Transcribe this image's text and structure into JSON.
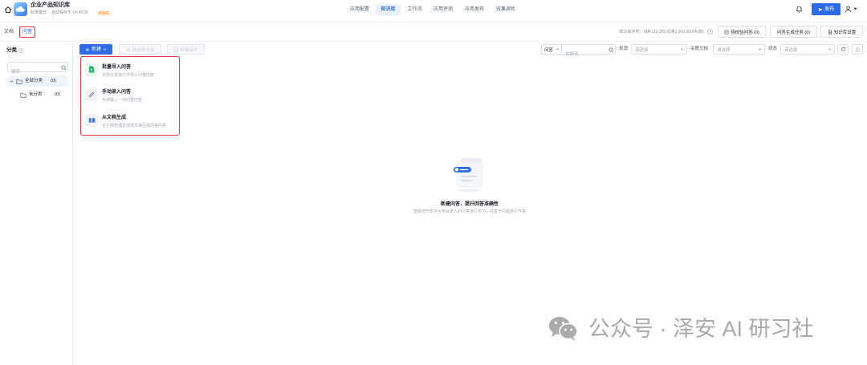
{
  "header": {
    "app_title": "企业产品知识库",
    "mode": "标准模式",
    "autosave": "自动保存于 14:49:56",
    "status_badge": "待发布",
    "nav_tabs": [
      {
        "label": "应用配置",
        "active": false
      },
      {
        "label": "知识库",
        "active": true
      },
      {
        "label": "工作流",
        "active": false
      },
      {
        "label": "应用评测",
        "active": false
      },
      {
        "label": "应用发布",
        "active": false
      },
      {
        "label": "效果调优",
        "active": false
      }
    ],
    "publish_label": "发布"
  },
  "subnav": {
    "tabs": [
      {
        "label": "文档",
        "active": false
      },
      {
        "label": "问答",
        "active": true
      }
    ],
    "usage_text": "知识库字符：消耗119,081/总量2,000,000/失效0",
    "pending_review_label": "待校验问答 (0)",
    "generation_tasks_label": "问答生成任务 (0)",
    "settings_label": "知识库设置"
  },
  "sidebar": {
    "title": "分类",
    "search_placeholder": "搜索",
    "tree": [
      {
        "label": "全部分类",
        "count": "(0)",
        "expanded": true,
        "selected": true
      },
      {
        "label": "未分类",
        "count": "(0)",
        "expanded": false,
        "selected": false
      }
    ]
  },
  "toolbar": {
    "new_label": "新建",
    "move_label": "移动到分类",
    "batch_label": "批量操作"
  },
  "filters": {
    "search_scope": "问答",
    "keyword_placeholder": "关键词",
    "source_label": "来源",
    "source_placeholder": "请选择",
    "related_doc_label": "关联文档",
    "related_doc_placeholder": "请选择",
    "status_label": "状态",
    "status_placeholder": "请选择"
  },
  "new_menu": [
    {
      "icon": "file-upload-icon",
      "title": "批量导入问答",
      "desc": "支持从本地文件导入问答内容"
    },
    {
      "icon": "pencil-icon",
      "title": "手动录入问答",
      "desc": "手动输入一对问答内容"
    },
    {
      "icon": "book-icon",
      "title": "从文档生成",
      "desc": "在文档管理里选择文档生成问答内容"
    }
  ],
  "empty_state": {
    "title": "新建问答，提升回答准确性",
    "desc": "智能体开发平台将对录入的问答进行学习，并基于问题进行作答"
  },
  "watermark": "公众号 · 泽安 AI 研习社",
  "colors": {
    "primary": "#2e6be6",
    "highlight_outline": "#e5393f",
    "badge_text": "#ff7d00",
    "badge_bg": "#fff3e8",
    "active_tab_bg": "#e8f0ff",
    "selected_row_bg": "#eef2fb",
    "success_green": "#20b463"
  }
}
